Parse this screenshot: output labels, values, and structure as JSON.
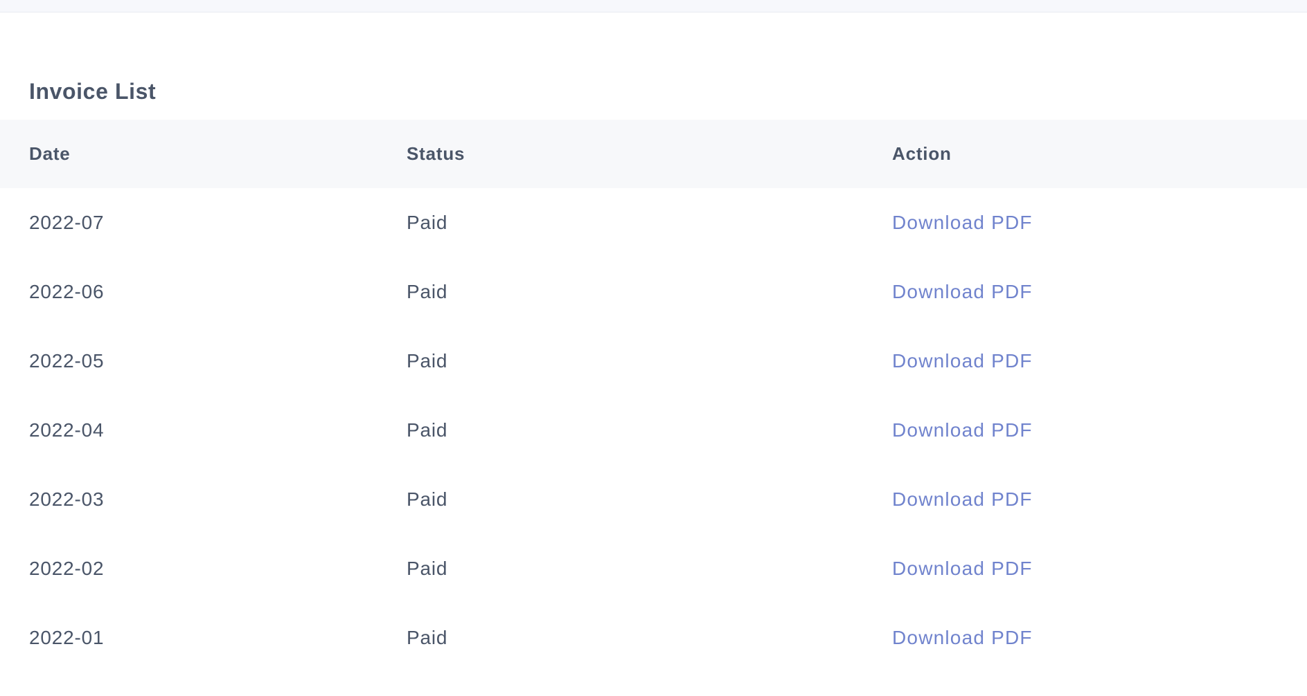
{
  "section": {
    "title": "Invoice List"
  },
  "table": {
    "headers": {
      "date": "Date",
      "status": "Status",
      "action": "Action"
    },
    "rows": [
      {
        "date": "2022-07",
        "status": "Paid",
        "action": "Download PDF"
      },
      {
        "date": "2022-06",
        "status": "Paid",
        "action": "Download PDF"
      },
      {
        "date": "2022-05",
        "status": "Paid",
        "action": "Download PDF"
      },
      {
        "date": "2022-04",
        "status": "Paid",
        "action": "Download PDF"
      },
      {
        "date": "2022-03",
        "status": "Paid",
        "action": "Download PDF"
      },
      {
        "date": "2022-02",
        "status": "Paid",
        "action": "Download PDF"
      },
      {
        "date": "2022-01",
        "status": "Paid",
        "action": "Download PDF"
      }
    ]
  },
  "colors": {
    "text": "#4a5568",
    "link": "#7083cd",
    "header_bg": "#f7f8fa",
    "top_strip_bg": "#f7f8fc"
  }
}
